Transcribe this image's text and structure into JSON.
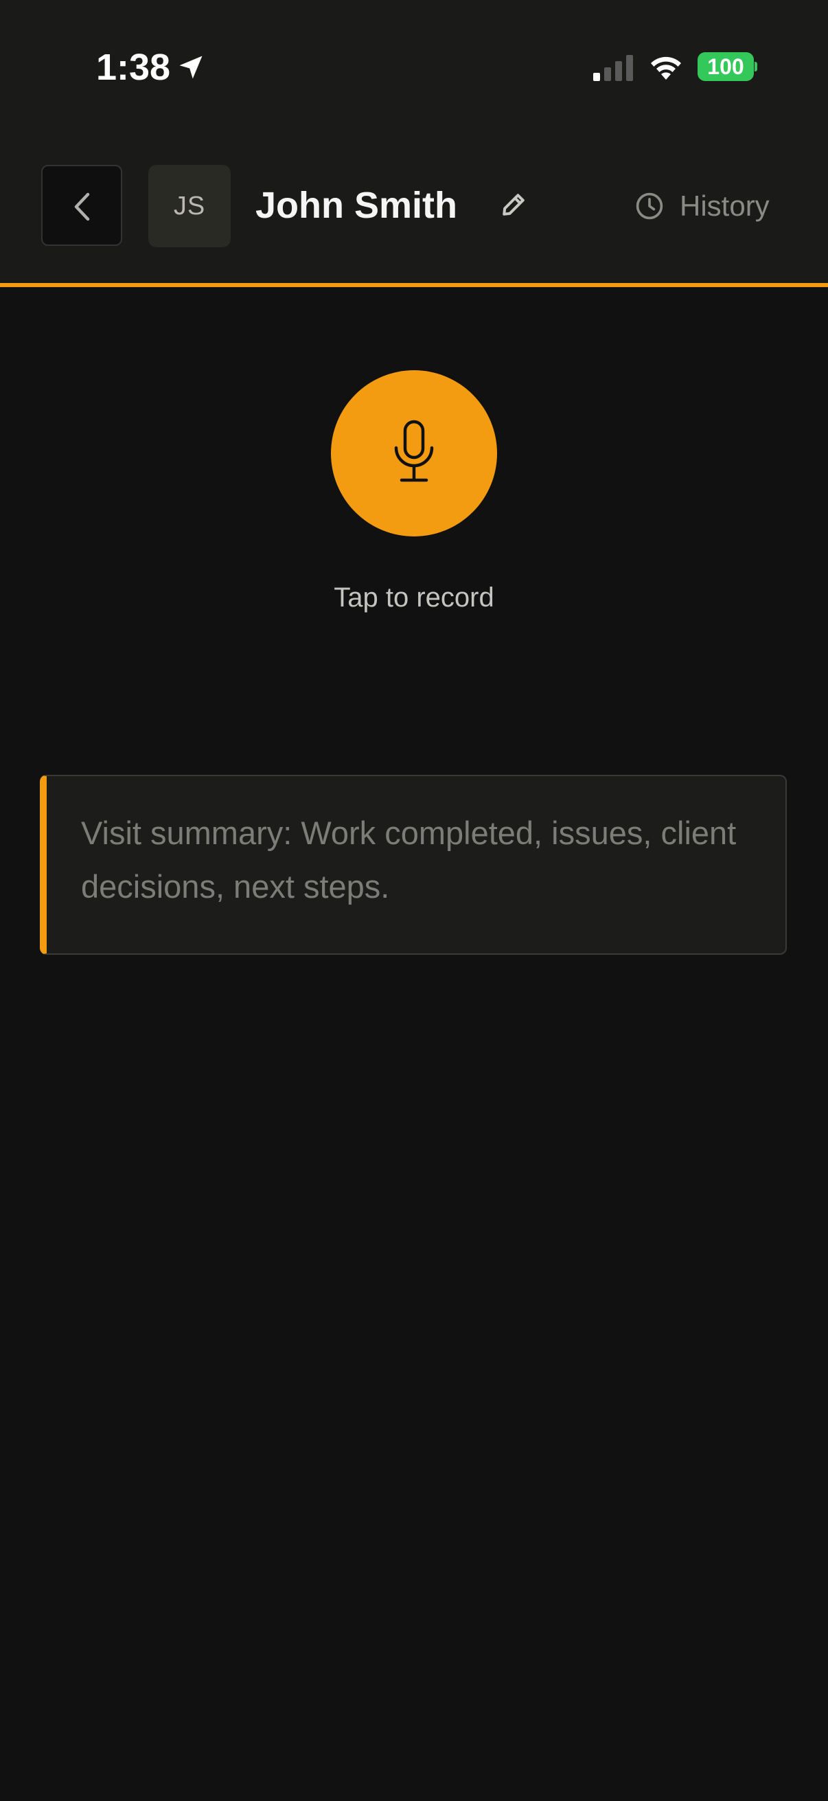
{
  "status_bar": {
    "time": "1:38",
    "battery_level": "100",
    "icons": [
      "location-arrow-icon",
      "cellular-signal-icon",
      "wifi-icon",
      "battery-icon"
    ]
  },
  "header": {
    "back_icon": "chevron-left-icon",
    "avatar_initials": "JS",
    "client_name": "John Smith",
    "edit_icon": "pencil-icon",
    "history_icon": "clock-icon",
    "history_label": "History"
  },
  "recorder": {
    "icon": "microphone-icon",
    "caption": "Tap to record"
  },
  "summary": {
    "value": "",
    "placeholder": "Visit summary: Work completed, issues, client decisions, next steps."
  },
  "colors": {
    "accent": "#f39c12",
    "background": "#111111",
    "header_background": "#1a1a18",
    "battery": "#34c759"
  }
}
